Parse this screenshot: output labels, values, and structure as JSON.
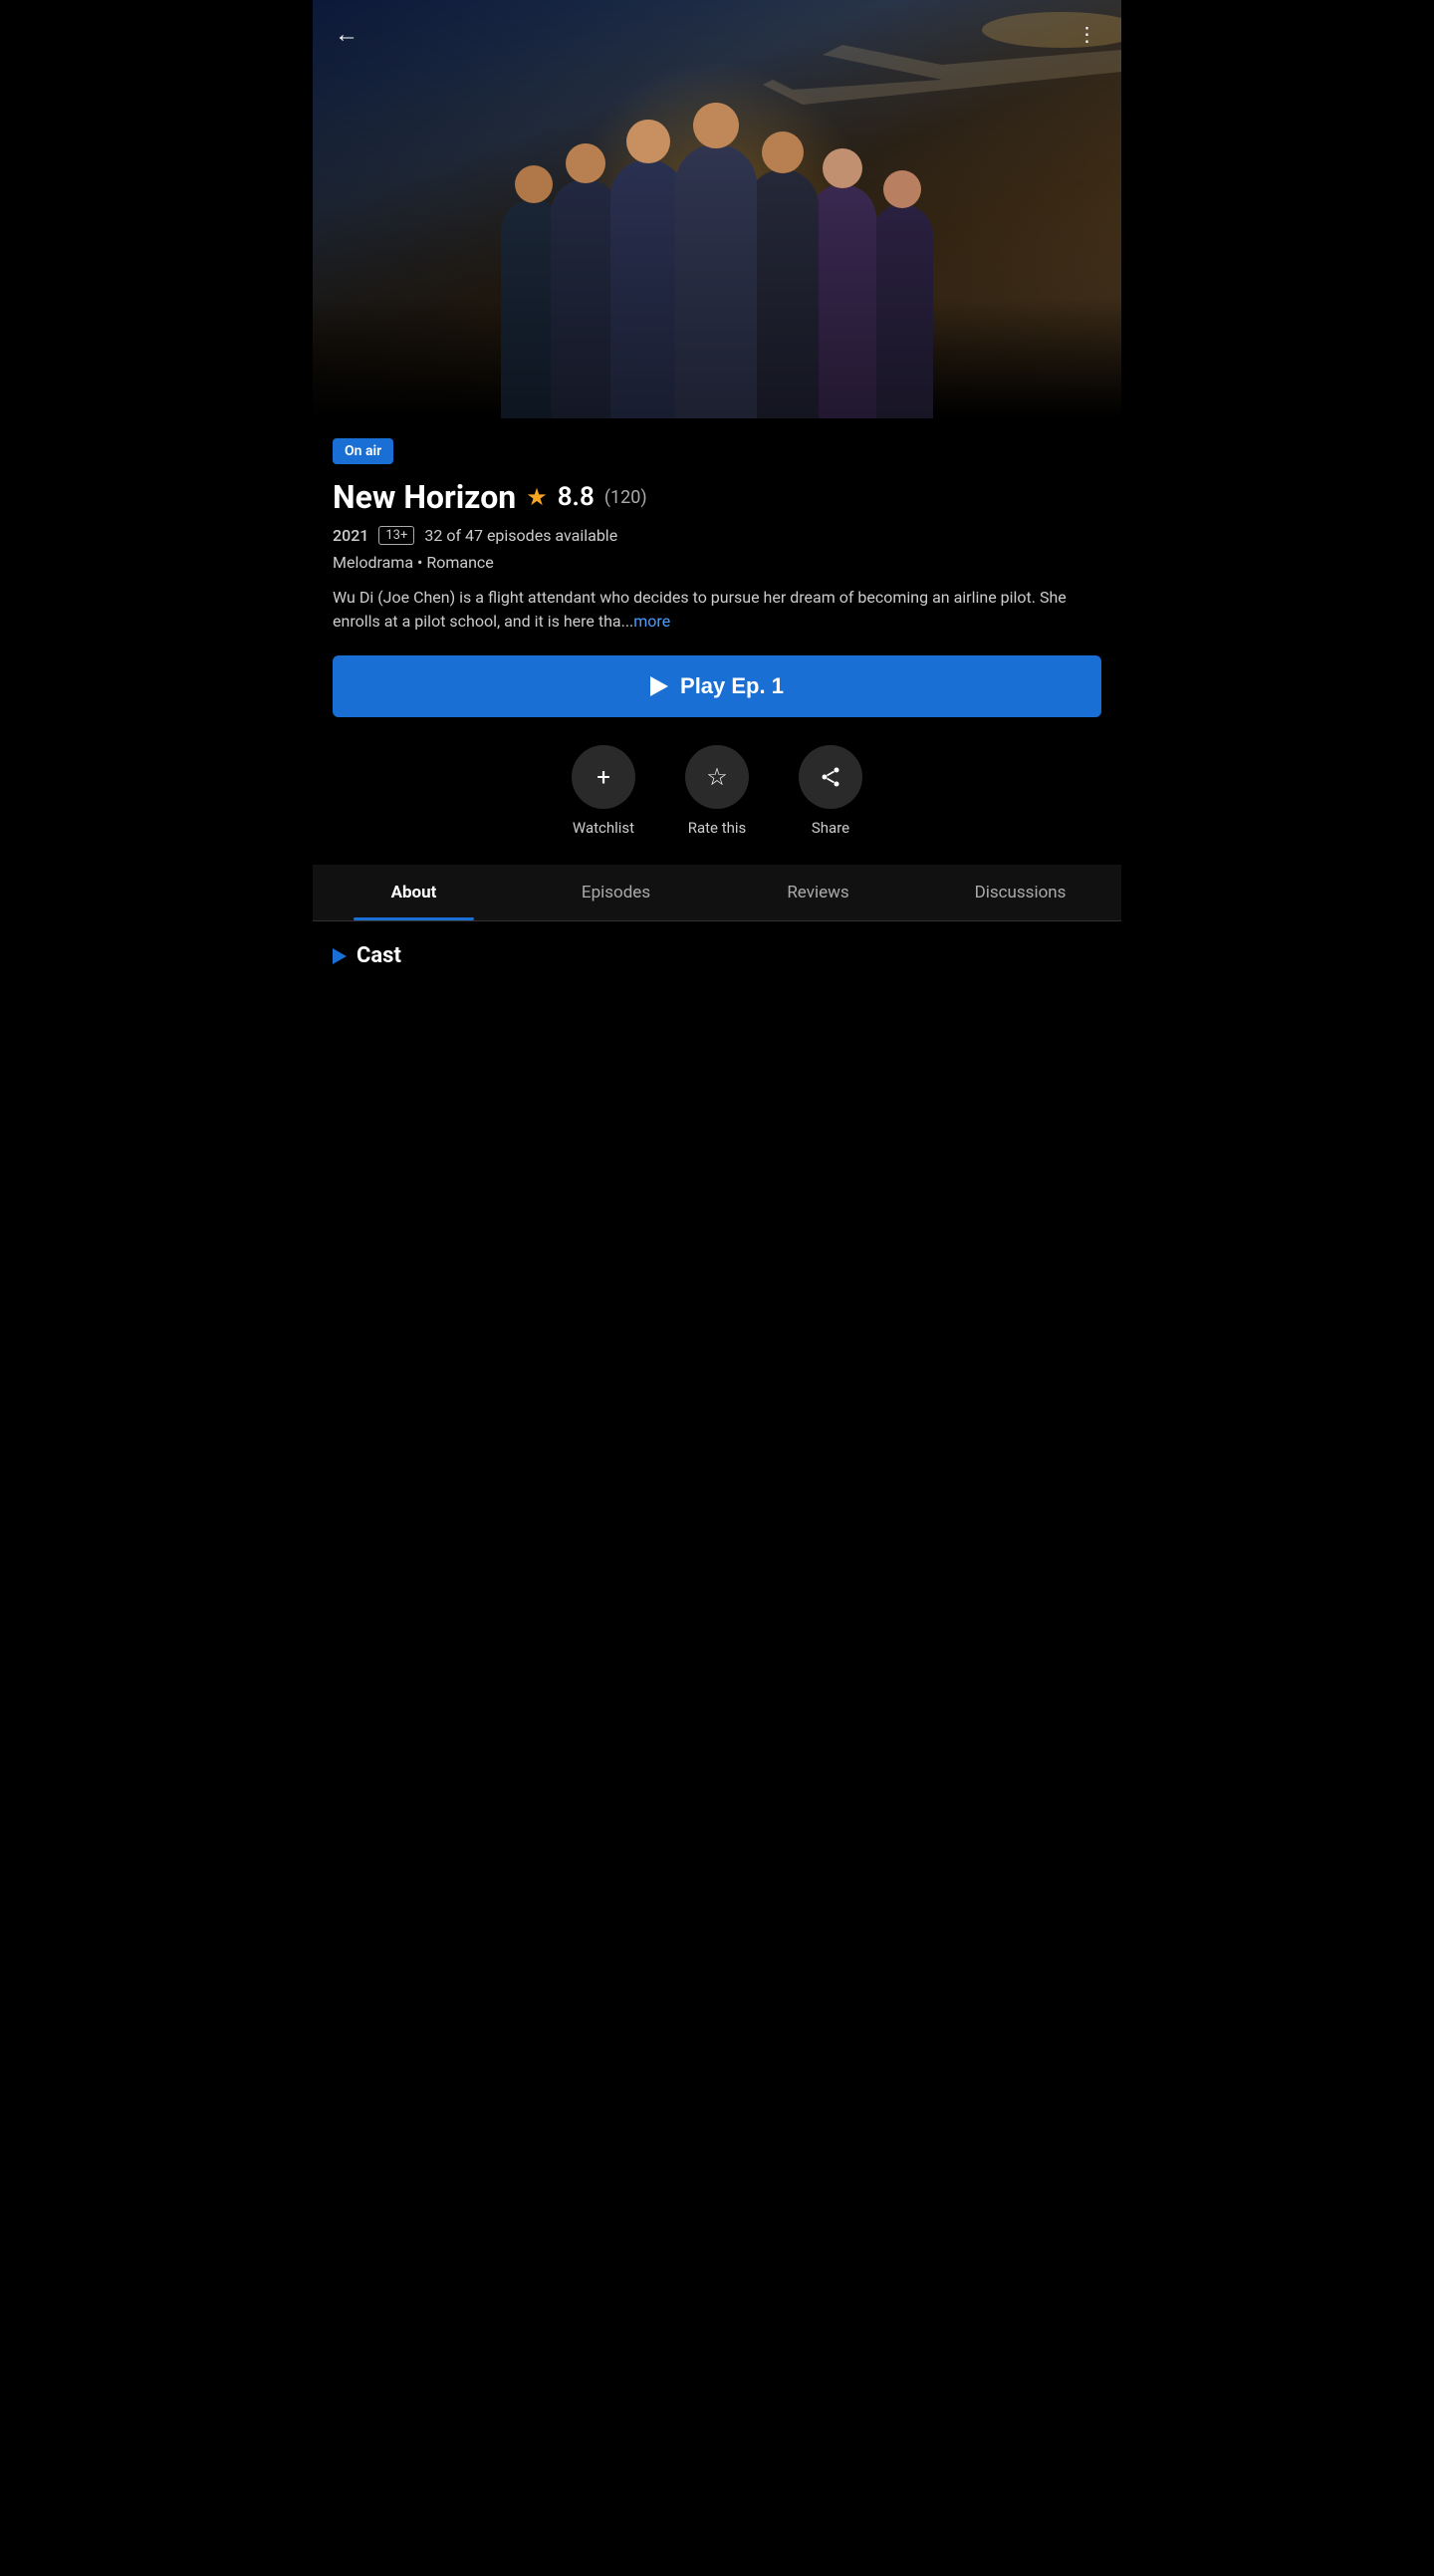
{
  "header": {
    "back_label": "←",
    "more_label": "⋮"
  },
  "badge": {
    "label": "On air"
  },
  "show": {
    "title": "New Horizon",
    "rating": "8.8",
    "rating_count": "(120)",
    "year": "2021",
    "age_rating": "13+",
    "episodes_info": "32 of 47 episodes available",
    "genres": "Melodrama • Romance",
    "description": "Wu Di (Joe Chen) is a flight attendant who decides to pursue her dream of becoming an airline pilot. She enrolls at a pilot school, and it is here tha...",
    "more_link": "more"
  },
  "play_button": {
    "label": "Play Ep. 1"
  },
  "actions": [
    {
      "id": "watchlist",
      "icon": "+",
      "label": "Watchlist"
    },
    {
      "id": "rate",
      "icon": "★",
      "label": "Rate this"
    },
    {
      "id": "share",
      "icon": "share",
      "label": "Share"
    }
  ],
  "tabs": [
    {
      "id": "about",
      "label": "About",
      "active": true
    },
    {
      "id": "episodes",
      "label": "Episodes",
      "active": false
    },
    {
      "id": "reviews",
      "label": "Reviews",
      "active": false
    },
    {
      "id": "discussions",
      "label": "Discussions",
      "active": false
    }
  ],
  "cast_section": {
    "title": "Cast"
  }
}
